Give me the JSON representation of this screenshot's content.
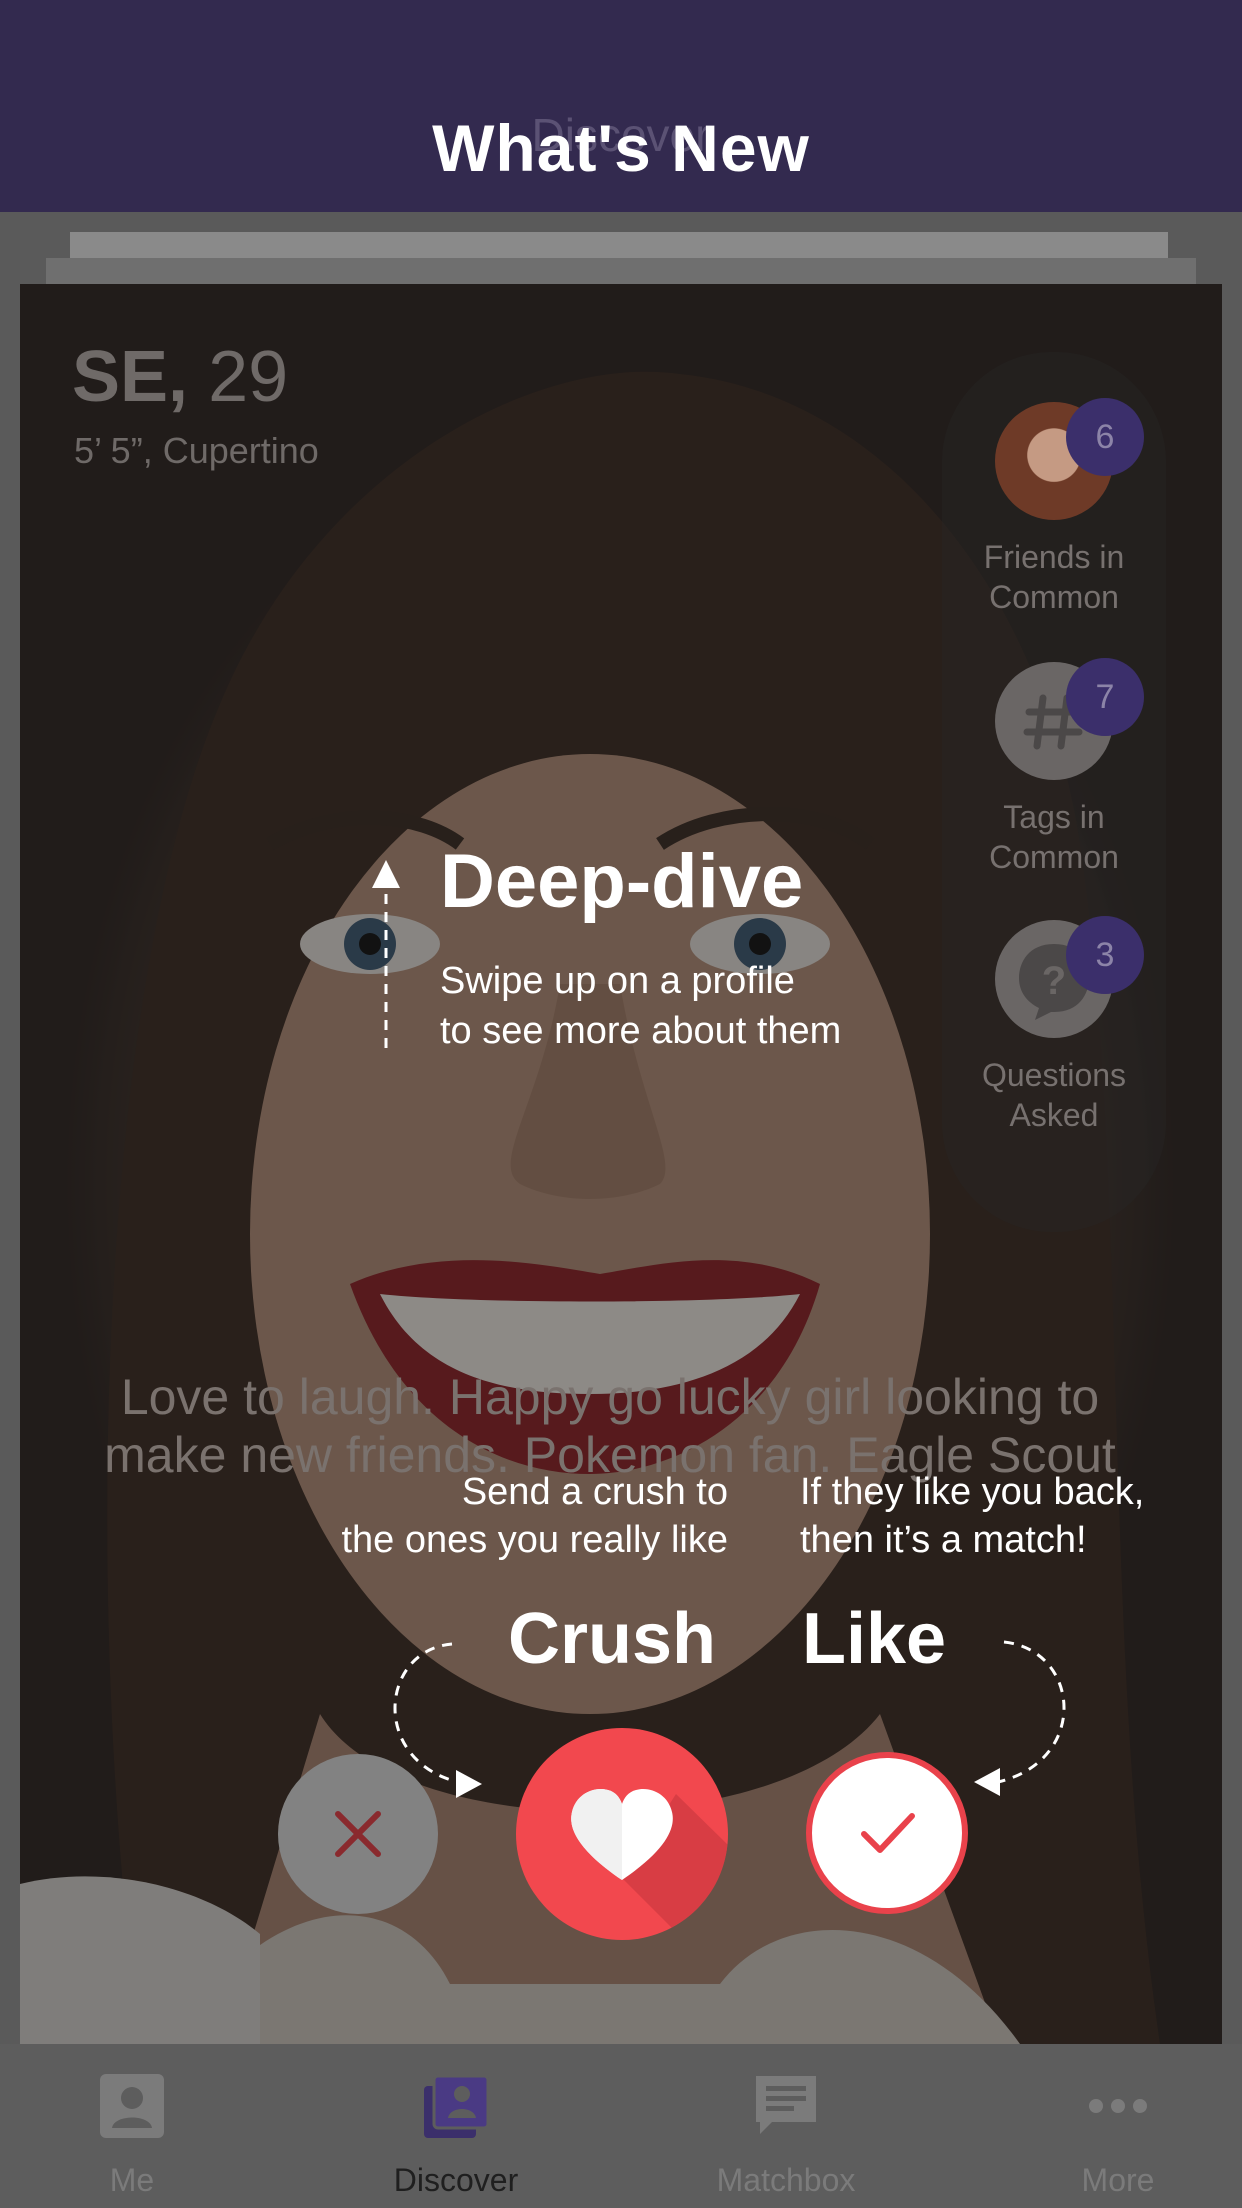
{
  "header": {
    "behind_title": "Discover",
    "title": "What's New"
  },
  "profile": {
    "initials": "SE,",
    "age": "29",
    "details": "5’ 5”, Cupertino",
    "bio_line1": "Love to laugh. Happy go lucky girl looking to",
    "bio_line2": "make new friends. Pokemon fan. Eagle Scout"
  },
  "common": {
    "friends": {
      "count": "6",
      "label_line1": "Friends in",
      "label_line2": "Common"
    },
    "tags": {
      "count": "7",
      "label_line1": "Tags in",
      "label_line2": "Common"
    },
    "questions": {
      "count": "3",
      "label_line1": "Questions",
      "label_line2": "Asked"
    }
  },
  "tutorial": {
    "deepdive_title": "Deep-dive",
    "deepdive_line1": "Swipe up on a profile",
    "deepdive_line2": "to see more about them",
    "crush_line1": "Send a crush to",
    "crush_line2": "the ones you really like",
    "like_line1": "If they like you back,",
    "like_line2": "then it’s a match!",
    "crush_title": "Crush",
    "like_title": "Like"
  },
  "nav": {
    "items": [
      {
        "label": "Me",
        "icon": "person-icon"
      },
      {
        "label": "Discover",
        "icon": "cards-icon"
      },
      {
        "label": "Matchbox",
        "icon": "chat-icon"
      },
      {
        "label": "More",
        "icon": "more-dots-icon"
      }
    ],
    "active": "Discover"
  },
  "colors": {
    "header_bg": "#332a4f",
    "accent_purple": "#3b2f6b",
    "crush_red": "#f2484e",
    "like_red": "#e9424b"
  }
}
